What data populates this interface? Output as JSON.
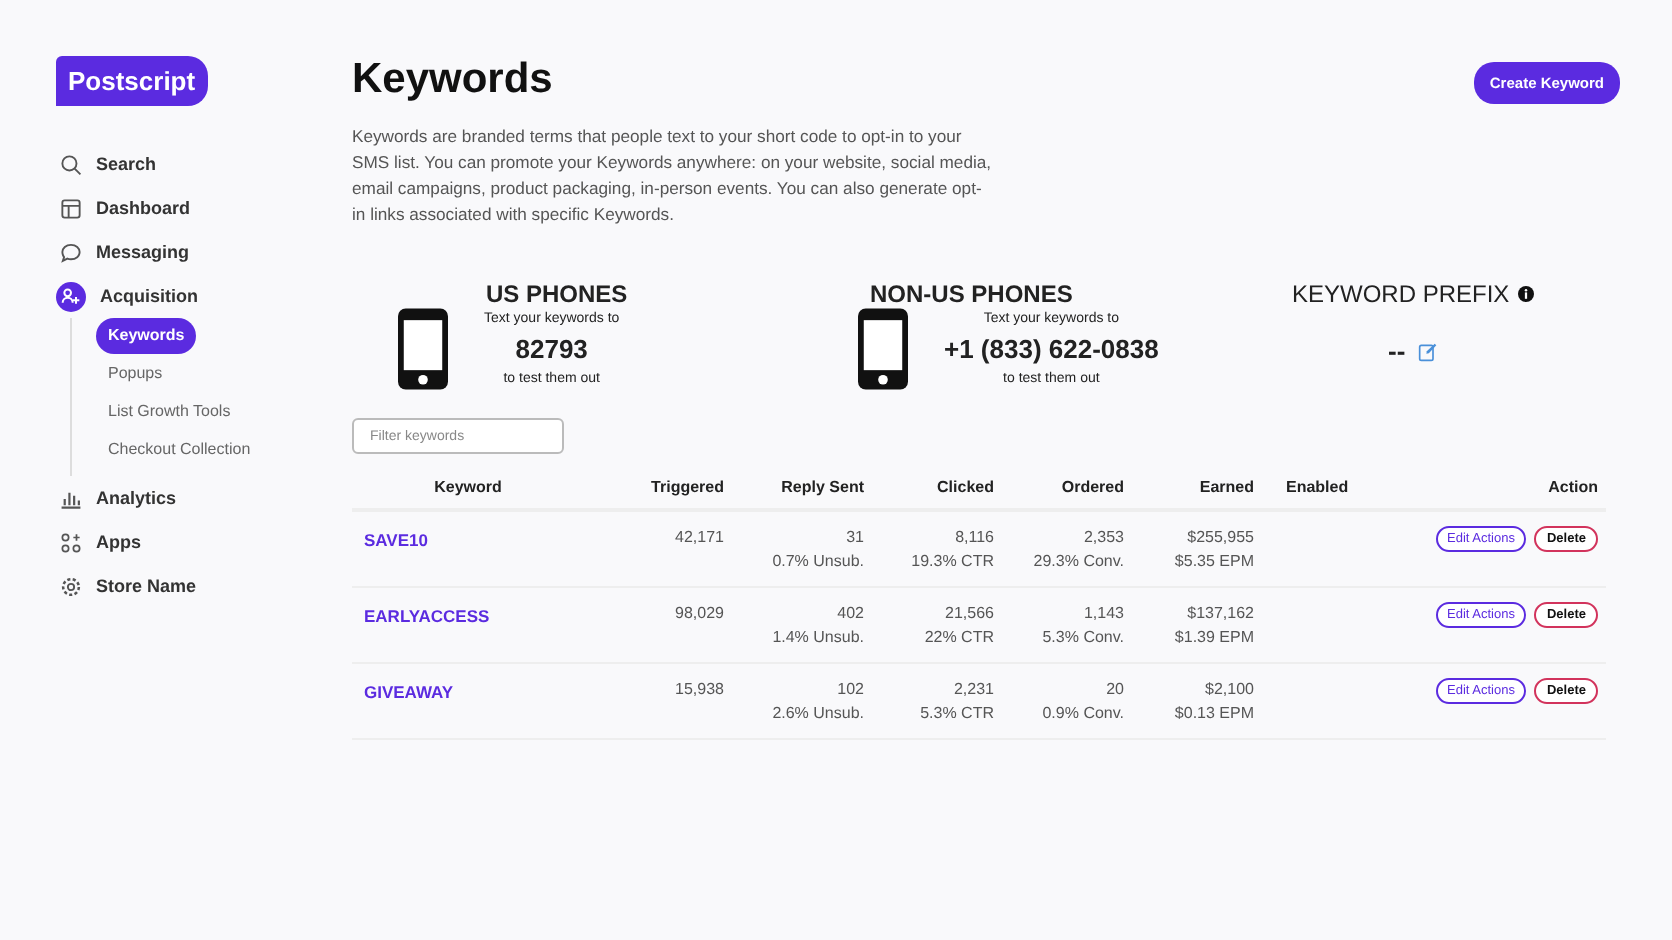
{
  "logo": "Postscript",
  "nav": [
    {
      "label": "Search",
      "kind": "search"
    },
    {
      "label": "Dashboard",
      "kind": "dashboard"
    },
    {
      "label": "Messaging",
      "kind": "chat"
    },
    {
      "label": "Acquisition",
      "kind": "people",
      "expanded": true,
      "children": [
        {
          "label": "Keywords",
          "selected": true
        },
        {
          "label": "Popups",
          "selected": false
        },
        {
          "label": "List Growth Tools",
          "selected": false
        },
        {
          "label": "Checkout Collection",
          "selected": false
        }
      ]
    },
    {
      "label": "Analytics",
      "kind": "chart"
    },
    {
      "label": "Apps",
      "kind": "apps"
    },
    {
      "label": "Store Name",
      "kind": "gear"
    }
  ],
  "title": "Keywords",
  "create_button": "Create Keyword",
  "description": "Keywords are branded terms that people text to your short code to opt-in to your SMS list. You can promote your Keywords anywhere: on your website, social media, email campaigns, product packaging, in-person events. You can also generate opt-in links associated with specific Keywords.",
  "phones": [
    {
      "heading": "US PHONES",
      "line1": "Text your keywords to",
      "number": "82793",
      "line2": "to test them out"
    },
    {
      "heading": "NON-US PHONES",
      "line1": "Text your keywords to",
      "number": "+1 (833) 622-0838",
      "line2": "to test them out"
    }
  ],
  "prefix": {
    "heading": "KEYWORD PREFIX",
    "value": "--"
  },
  "filter": {
    "placeholder": "Filter keywords"
  },
  "table": {
    "columns": [
      "Keyword",
      "Triggered",
      "Reply Sent",
      "Clicked",
      "Ordered",
      "Earned",
      "Enabled",
      "Action"
    ],
    "rows": [
      {
        "keyword": "SAVE10",
        "triggered": "42,171",
        "reply_sent": [
          "31",
          "0.7% Unsub."
        ],
        "clicked": [
          "8,116",
          "19.3% CTR"
        ],
        "ordered": [
          "2,353",
          "29.3% Conv."
        ],
        "earned": [
          "$255,955",
          "$5.35 EPM"
        ],
        "actions": [
          "Edit Actions",
          "Delete"
        ]
      },
      {
        "keyword": "EARLYACCESS",
        "triggered": "98,029",
        "reply_sent": [
          "402",
          "1.4% Unsub."
        ],
        "clicked": [
          "21,566",
          "22% CTR"
        ],
        "ordered": [
          "1,143",
          "5.3% Conv."
        ],
        "earned": [
          "$137,162",
          "$1.39 EPM"
        ],
        "actions": [
          "Edit Actions",
          "Delete"
        ]
      },
      {
        "keyword": "GIVEAWAY",
        "triggered": "15,938",
        "reply_sent": [
          "102",
          "2.6% Unsub."
        ],
        "clicked": [
          "2,231",
          "5.3% CTR"
        ],
        "ordered": [
          "20",
          "0.9% Conv."
        ],
        "earned": [
          "$2,100",
          "$0.13 EPM"
        ],
        "actions": [
          "Edit Actions",
          "Delete"
        ]
      }
    ]
  }
}
